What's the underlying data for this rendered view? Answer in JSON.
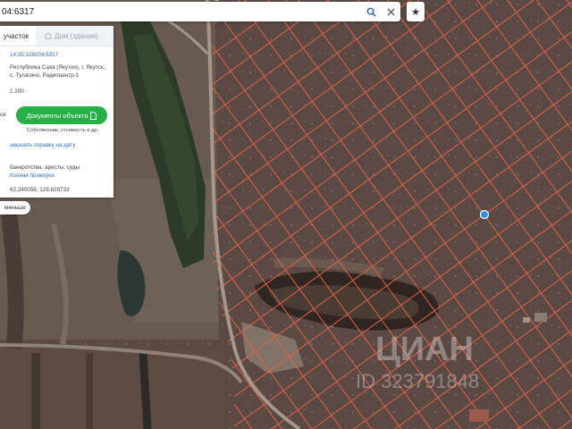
{
  "search": {
    "query": "04:6317"
  },
  "panel": {
    "tab_active": "участок",
    "tab_inactive": "Дом (здание)",
    "cadastral_number": "14:35:106004:6317",
    "address_lines": [
      "Республика Саха (Якутия), г. Якутск,",
      "с. Тулагино, Радиоцентр-1"
    ],
    "area_value": "1 200",
    "docs_button_label": "Документы объекта",
    "docs_caption": "Собственник, стоимость и др.",
    "side_label": "ся",
    "order_link": "заказать справку на дату",
    "checks_text": "банкротства, аресты, суды",
    "full_check_link": "полная проверка",
    "coordinates": "62.240058, 129.828733",
    "less_button": "меньше"
  },
  "watermark": {
    "brand": "ЦИАН",
    "id_text": "ID 323791848"
  },
  "colors": {
    "parcel_lines": "#e2604a",
    "link": "#2b70c9",
    "docs_button": "#26b046",
    "marker": "#2f8fe0",
    "tab_inactive_bg": "#eef3f7"
  },
  "icons": [
    "search-icon",
    "close-icon",
    "star-icon",
    "home-icon",
    "document-icon",
    "location-marker"
  ]
}
